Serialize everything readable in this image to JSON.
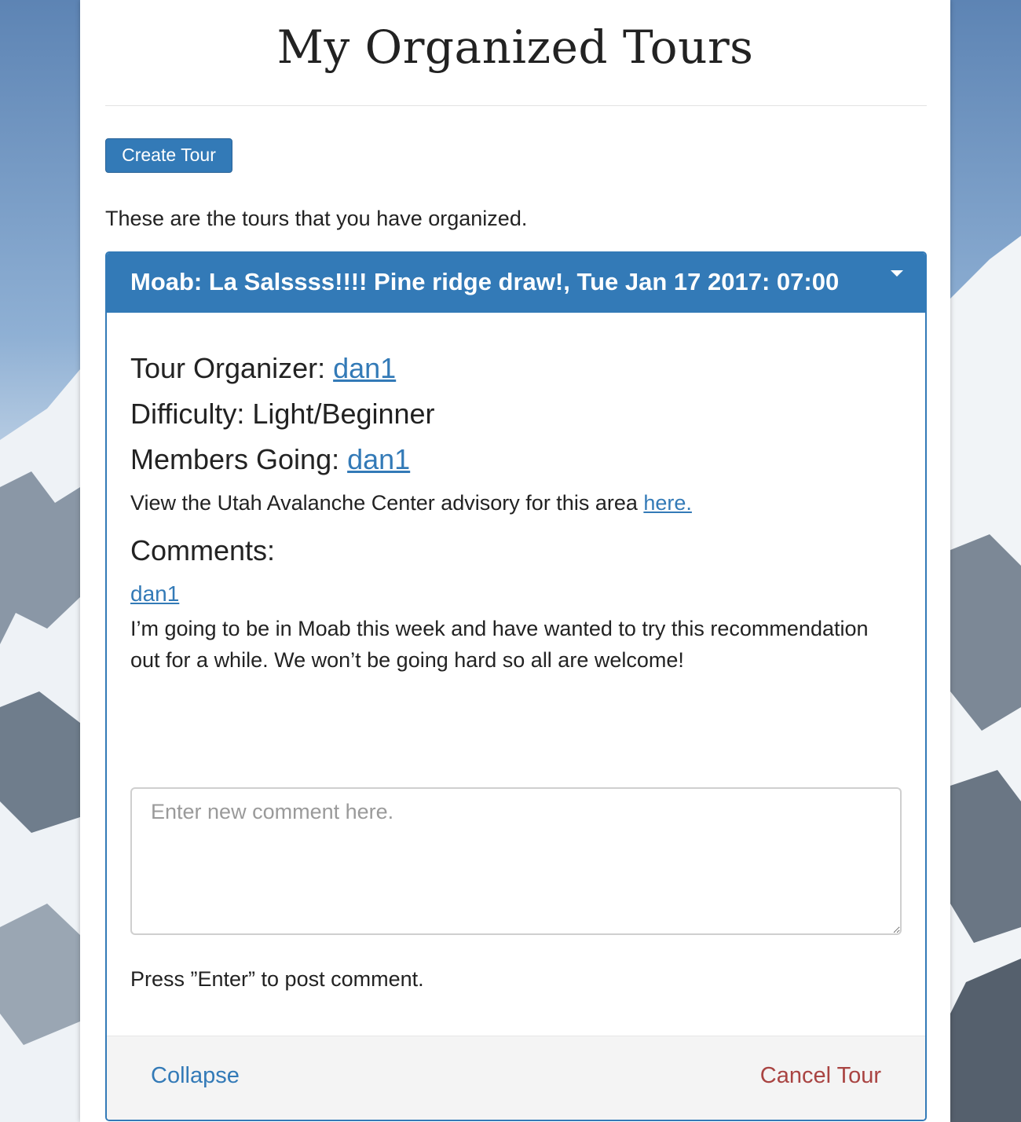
{
  "page": {
    "title": "My Organized Tours"
  },
  "toolbar": {
    "create_tour_label": "Create Tour"
  },
  "intro_text": "These are the tours that you have organized.",
  "tour": {
    "header": "Moab: La Salssss!!!! Pine ridge draw!, Tue Jan 17 2017: 07:00",
    "organizer_label": "Tour Organizer: ",
    "organizer": "dan1",
    "difficulty_label": "Difficulty: ",
    "difficulty": "Light/Beginner",
    "members_label": "Members Going: ",
    "members": [
      "dan1"
    ],
    "advisory_text": "View the Utah Avalanche Center advisory for this area ",
    "advisory_link": "here.",
    "comments_heading": "Comments:",
    "comments": [
      {
        "author": "dan1",
        "text": "I’m going to be in Moab this week and have wanted to try this recommendation out for a while. We won’t be going hard so all are welcome!"
      }
    ],
    "comment_input": {
      "placeholder": "Enter new comment here.",
      "value": ""
    },
    "post_hint": "Press ”Enter” to post comment.",
    "footer": {
      "collapse_label": "Collapse",
      "cancel_label": "Cancel Tour"
    }
  },
  "colors": {
    "primary": "#337ab7",
    "danger": "#a94442",
    "footer_bg": "#f4f4f4"
  },
  "icons": {
    "header_toggle": "caret-down-icon"
  }
}
